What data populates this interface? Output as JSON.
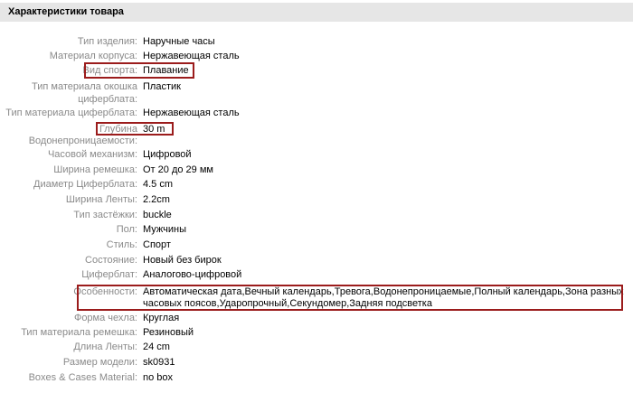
{
  "header": {
    "title": "Характеристики товара"
  },
  "rows": [
    {
      "label": "Тип изделия:",
      "value": "Наручные часы"
    },
    {
      "label": "Материал корпуса:",
      "value": "Нержавеющая сталь"
    },
    {
      "label": "Вид спорта:",
      "value": "Плавание"
    },
    {
      "label_line1": "Тип материала окошка",
      "label_line2": "циферблата:",
      "value": "Пластик"
    },
    {
      "label": "Тип материала циферблата:",
      "value": "Нержавеющая сталь"
    },
    {
      "label_line1": "Глубина",
      "label_line2": "Водонепроницаемости:",
      "value": "30 m"
    },
    {
      "label": "Часовой механизм:",
      "value": "Цифровой"
    },
    {
      "label": "Ширина ремешка:",
      "value": "От 20 до 29 мм"
    },
    {
      "label": "Диаметр Циферблата:",
      "value": "4.5 cm"
    },
    {
      "label": "Ширина Ленты:",
      "value": "2.2cm"
    },
    {
      "label": "Тип застёжки:",
      "value": "buckle"
    },
    {
      "label": "Пол:",
      "value": "Мужчины"
    },
    {
      "label": "Стиль:",
      "value": "Спорт"
    },
    {
      "label": "Состояние:",
      "value": "Новый без бирок"
    },
    {
      "label": "Циферблат:",
      "value": "Аналогово-цифровой"
    },
    {
      "label": "Особенности:",
      "value": "Автоматическая дата,Вечный календарь,Тревога,Водонепроницаемые,Полный календарь,Зона разных часовых поясов,Ударопрочный,Секундомер,Задняя подсветка"
    },
    {
      "label": "Форма чехла:",
      "value": "Круглая"
    },
    {
      "label": "Тип материала ремешка:",
      "value": "Резиновый"
    },
    {
      "label": "Длина Ленты:",
      "value": "24 cm"
    },
    {
      "label": "Размер модели:",
      "value": "sk0931"
    },
    {
      "label": "Boxes & Cases Material:",
      "value": "no box"
    }
  ],
  "colors": {
    "highlight": "#9b1c1c",
    "header_bg": "#e6e6e6",
    "label": "#8a8a8a"
  }
}
